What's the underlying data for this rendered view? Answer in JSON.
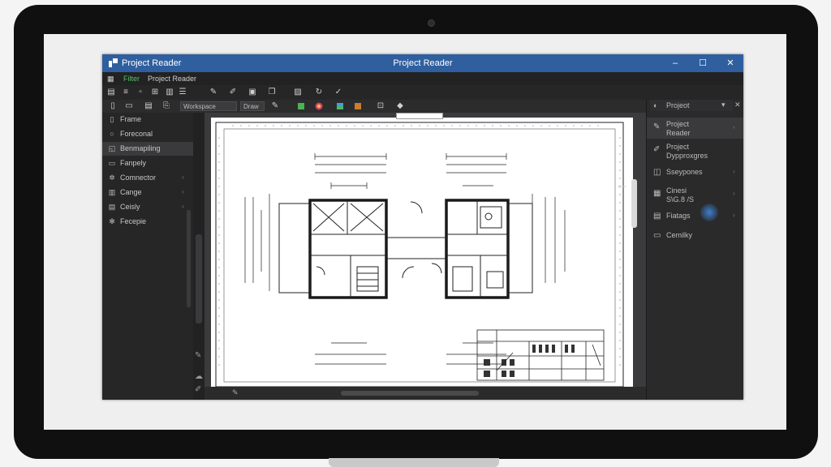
{
  "window": {
    "title_left": "Project Reader",
    "title_center": "Project Reader",
    "controls": {
      "minimize": "–",
      "maximize": "☐",
      "close": "✕"
    }
  },
  "menubar": {
    "items": [
      "Filter",
      "Project Reader"
    ]
  },
  "toolbar": {
    "select1": "Workspace",
    "select2": "Draw"
  },
  "sidebar": {
    "items": [
      {
        "label": "Frame",
        "icon": "page-icon"
      },
      {
        "label": "Foreconal",
        "icon": "circle-icon"
      },
      {
        "label": "Benmapiling",
        "icon": "layers-icon"
      },
      {
        "label": "Fanpely",
        "icon": "folder-icon"
      },
      {
        "label": "Comnector",
        "icon": "gear-icon"
      },
      {
        "label": "Cange",
        "icon": "chart-icon"
      },
      {
        "label": "Ceisly",
        "icon": "grid-icon"
      },
      {
        "label": "Fecepie",
        "icon": "settings-icon"
      }
    ],
    "active_index": 2
  },
  "right_panel": {
    "dropdown": "Projeot",
    "items": [
      {
        "line1": "Project",
        "line2": "Reader"
      },
      {
        "line1": "Project",
        "line2": "Dypproxgres"
      },
      {
        "line1": "Sseypones",
        "line2": ""
      },
      {
        "line1": "Cinesi",
        "line2": "S\\G.8 /S"
      },
      {
        "line1": "Fiatags",
        "line2": ""
      },
      {
        "line1": "Cemilky",
        "line2": ""
      }
    ],
    "active_index": 0
  },
  "colors": {
    "titlebar": "#2f5f9e",
    "accent_blue": "#3d7fd1"
  }
}
